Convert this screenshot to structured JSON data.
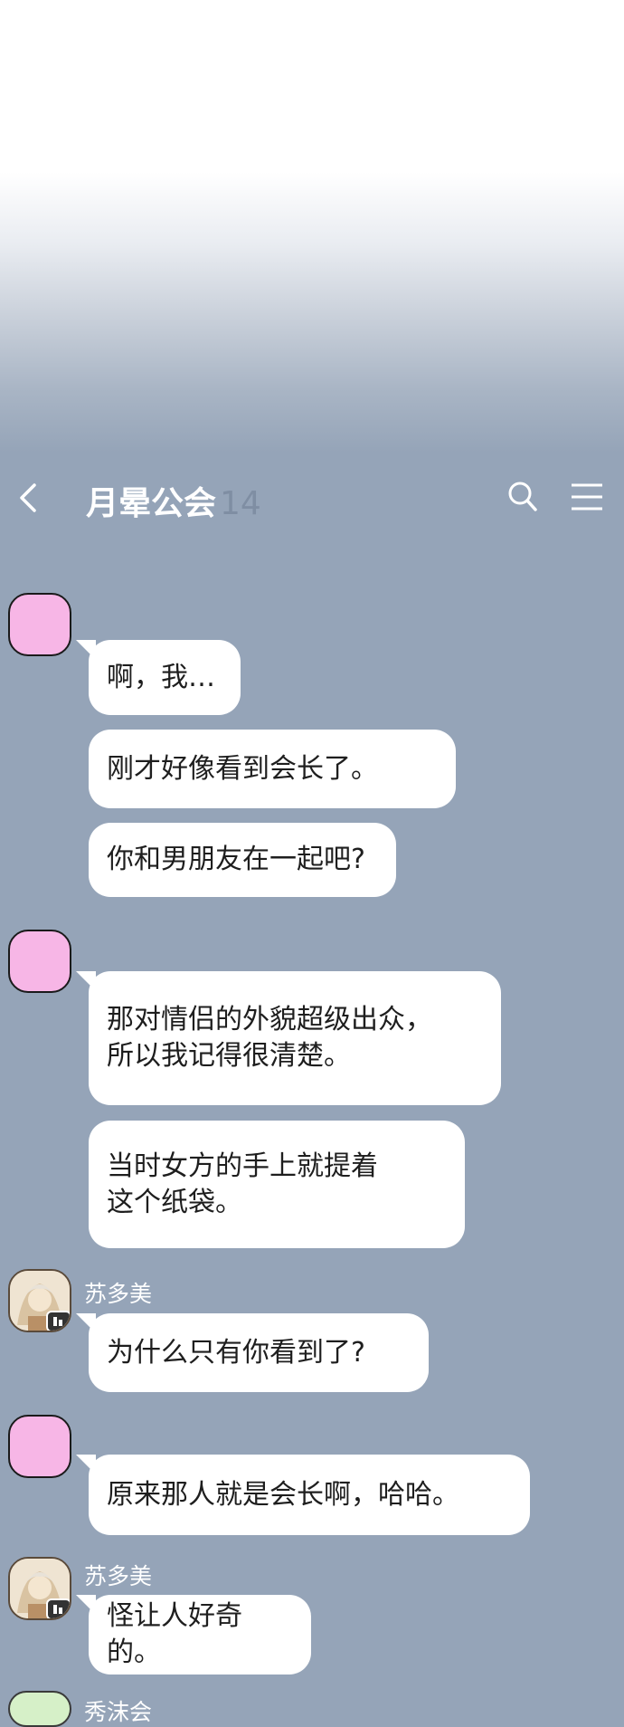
{
  "header": {
    "title": "月晕公会",
    "member_count": "14"
  },
  "messages": [
    {
      "sender": "",
      "text": "啊，我…"
    },
    {
      "sender": "",
      "text": "刚才好像看到会长了。"
    },
    {
      "sender": "",
      "text": "你和男朋友在一起吧?"
    },
    {
      "sender": "",
      "text": "那对情侣的外貌超级出众，\n所以我记得很清楚。"
    },
    {
      "sender": "",
      "text": "当时女方的手上就提着\n这个纸袋。"
    },
    {
      "sender": "苏多美",
      "text": "为什么只有你看到了?"
    },
    {
      "sender": "",
      "text": "原来那人就是会长啊，哈哈。"
    },
    {
      "sender": "苏多美",
      "text": "怪让人好奇的。"
    }
  ],
  "partial_next_sender": "秀沫会",
  "icons": {
    "back": "chevron-left-icon",
    "search": "search-icon",
    "menu": "hamburger-menu-icon"
  },
  "colors": {
    "background": "#95a4b8",
    "bubble": "#ffffff",
    "avatar_pink": "#f7b6e6"
  }
}
